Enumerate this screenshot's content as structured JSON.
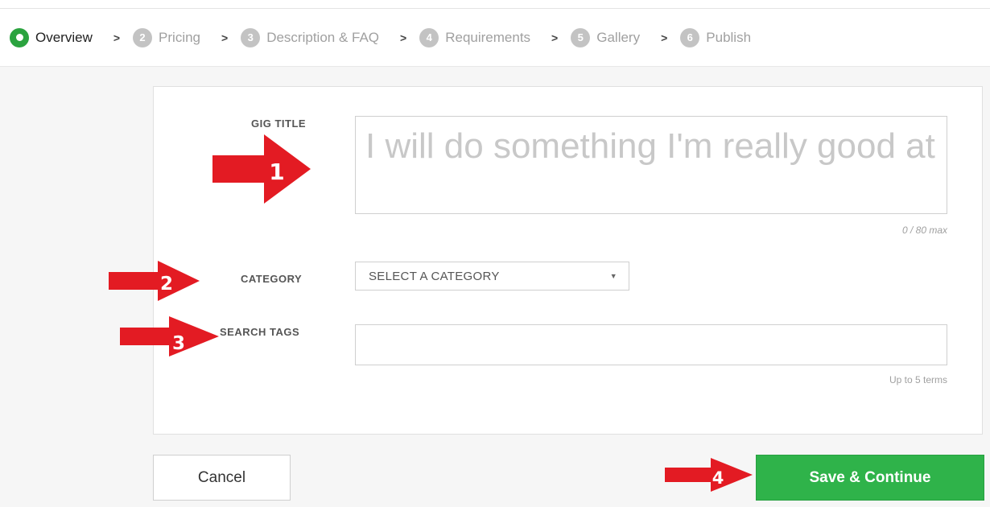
{
  "steps": [
    {
      "label": "Overview",
      "number": "",
      "active": true
    },
    {
      "label": "Pricing",
      "number": "2"
    },
    {
      "label": "Description & FAQ",
      "number": "3"
    },
    {
      "label": "Requirements",
      "number": "4"
    },
    {
      "label": "Gallery",
      "number": "5"
    },
    {
      "label": "Publish",
      "number": "6"
    }
  ],
  "separator": ">",
  "form": {
    "gig_title": {
      "label": "GIG TITLE",
      "placeholder": "I will do something I'm really good at",
      "counter": "0 / 80 max"
    },
    "category": {
      "label": "CATEGORY",
      "selected": "SELECT A CATEGORY"
    },
    "search_tags": {
      "label": "SEARCH TAGS",
      "value": "",
      "hint": "Up to 5 terms"
    }
  },
  "buttons": {
    "cancel": "Cancel",
    "save": "Save & Continue"
  },
  "annotations": {
    "a1": "1",
    "a2": "2",
    "a3": "3",
    "a4": "4"
  },
  "colors": {
    "accent_green": "#2fb34a",
    "arrow_red": "#e31b23",
    "step_inactive": "#c3c3c3"
  }
}
